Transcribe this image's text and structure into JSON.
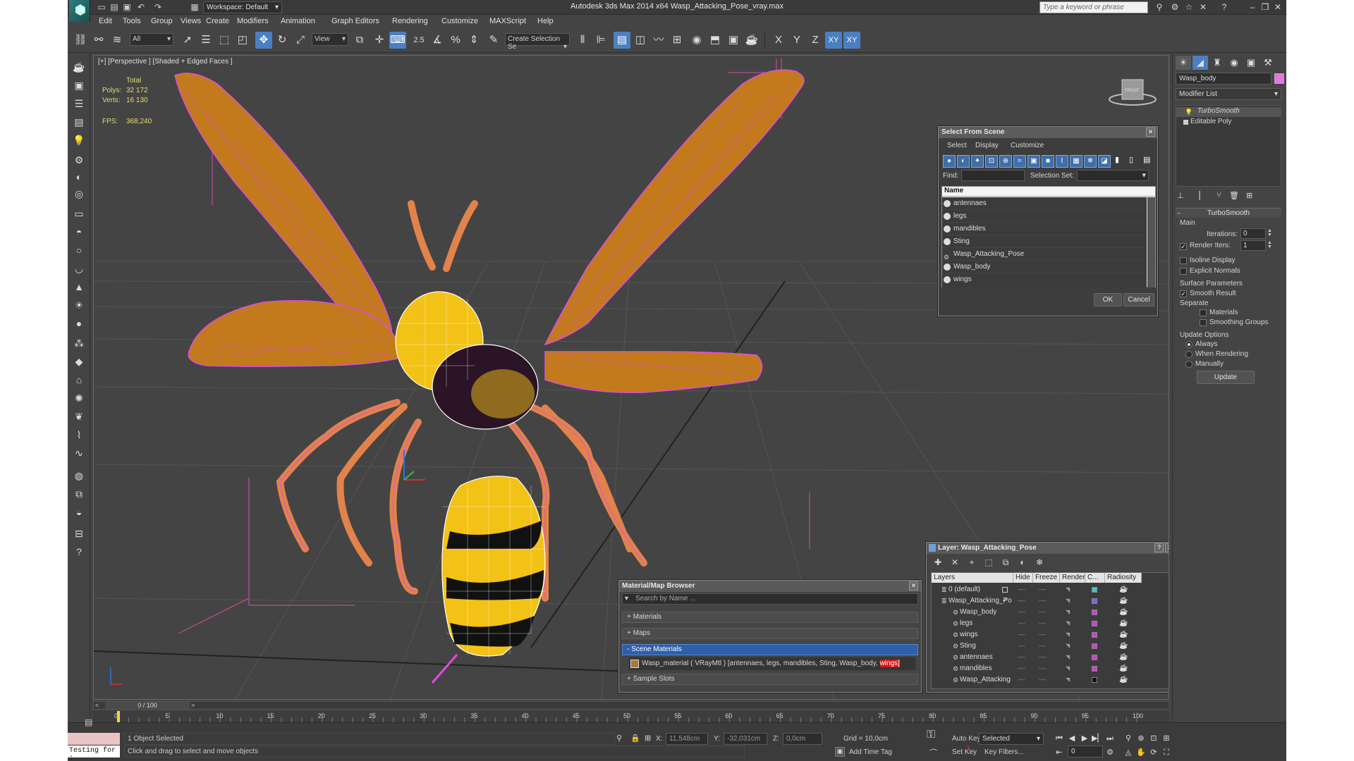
{
  "title_bar": {
    "title": "Autodesk 3ds Max  2014 x64     Wasp_Attacking_Pose_vray.max",
    "workspace": "Workspace: Default",
    "search_placeholder": "Type a keyword or phrase"
  },
  "menu": [
    "Edit",
    "Tools",
    "Group",
    "Views",
    "Create",
    "Modifiers",
    "Animation",
    "Graph Editors",
    "Rendering",
    "Customize",
    "MAXScript",
    "Help"
  ],
  "toolbar": {
    "filter": "All",
    "ref_coord": "View",
    "snap_angle": "2.5",
    "selection_set": "Create Selection Se",
    "axis_x": "X",
    "axis_y": "Y",
    "axis_z": "Z",
    "axis_xy": "XY",
    "axis_xy2": "XY"
  },
  "viewport": {
    "label": "[+] [Perspective ] [Shaded + Edged Faces ]",
    "stats": {
      "total_label": "Total",
      "polys_label": "Polys:",
      "polys": "32 172",
      "verts_label": "Verts:",
      "verts": "16 130",
      "fps_label": "FPS:",
      "fps": "368,240"
    },
    "viewcube_label": "FRONT"
  },
  "colors": {
    "wing_fill": "#c27a1c",
    "wire": "#e14ce1",
    "yellow": "#f2c216",
    "accent_blue": "#4a7fc1",
    "background": "#444444"
  },
  "select_from_scene": {
    "title": "Select From Scene",
    "menus": [
      "Select",
      "Display",
      "Customize"
    ],
    "find_label": "Find:",
    "find_value": "",
    "selection_set_label": "Selection Set:",
    "column_name": "Name",
    "items": [
      "antennaes",
      "legs",
      "mandibles",
      "Sting",
      "Wasp_Attacking_Pose",
      "Wasp_body",
      "wings"
    ],
    "ok": "OK",
    "cancel": "Cancel"
  },
  "material_browser": {
    "title": "Material/Map Browser",
    "search_placeholder": "Search by Name ...",
    "groups": [
      "+ Materials",
      "+ Maps",
      "- Scene Materials",
      "+ Sample Slots"
    ],
    "material_entry_prefix": "Wasp_material  ( VRayMtl ) [antennaes, legs, mandibles, Sting, Wasp_body, ",
    "material_entry_highlight": "wings]"
  },
  "layer_dialog": {
    "title": "Layer: Wasp_Attacking_Pose",
    "columns": [
      "Layers",
      "Hide",
      "Freeze",
      "Render",
      "C...",
      "Radiosity"
    ],
    "rows": [
      {
        "name": "0 (default)",
        "color": "#3fc7c7"
      },
      {
        "name": "Wasp_Attacking_Po",
        "color": "#6d6de8"
      },
      {
        "name": "Wasp_body",
        "color": "#c846c8"
      },
      {
        "name": "legs",
        "color": "#c846c8"
      },
      {
        "name": "wings",
        "color": "#c846c8"
      },
      {
        "name": "Sting",
        "color": "#c846c8"
      },
      {
        "name": "antennaes",
        "color": "#c846c8"
      },
      {
        "name": "mandibles",
        "color": "#c846c8"
      },
      {
        "name": "Wasp_Attacking",
        "color": "#111111"
      }
    ],
    "dash": "----"
  },
  "command_panel": {
    "object_name": "Wasp_body",
    "modifier_list": "Modifier List",
    "stack": [
      "TurboSmooth",
      "Editable Poly"
    ],
    "rollout_title": "TurboSmooth",
    "main_label": "Main",
    "iterations_label": "Iterations:",
    "iterations_value": "0",
    "render_iters_label": "Render Iters:",
    "render_iters_value": "1",
    "isoline_label": "Isoline Display",
    "explicit_label": "Explicit Normals",
    "surface_label": "Surface Parameters",
    "smooth_label": "Smooth Result",
    "separate_label": "Separate",
    "materials_label": "Materials",
    "smoothing_label": "Smoothing Groups",
    "update_options_label": "Update Options",
    "always_label": "Always",
    "when_rendering_label": "When Rendering",
    "manually_label": "Manually",
    "update_button": "Update"
  },
  "timeline": {
    "frame_counter": "0 / 100",
    "ticks": [
      "0",
      "5",
      "10",
      "15",
      "20",
      "25",
      "30",
      "35",
      "40",
      "45",
      "50",
      "55",
      "60",
      "65",
      "70",
      "75",
      "80",
      "85",
      "90",
      "95",
      "100"
    ]
  },
  "status": {
    "maxscript": "Testing for :",
    "selected": "1 Object Selected",
    "prompt": "Click and drag to select and move objects",
    "x_label": "X:",
    "x": "11,548cm",
    "y_label": "Y:",
    "y": "-32,031cm",
    "z_label": "Z:",
    "z": "0,0cm",
    "grid": "Grid = 10,0cm",
    "add_time_tag": "Add Time Tag",
    "auto_key": "Auto Key",
    "set_key": "Set Key",
    "selected_dropdown": "Selected",
    "key_filters": "Key Filters...",
    "frame": "0"
  }
}
